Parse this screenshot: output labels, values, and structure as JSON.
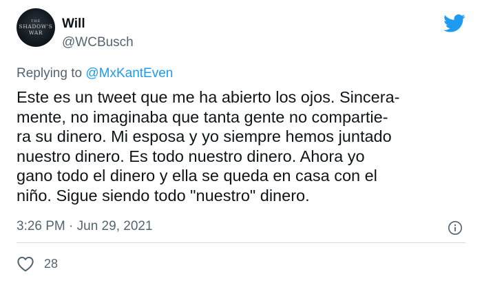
{
  "tweet": {
    "avatar": {
      "top_text": "THE",
      "line1": "SHADOW'S",
      "line2": "WAR"
    },
    "author": {
      "name": "Will",
      "handle": "@WCBusch"
    },
    "brand_icon": "twitter-bird-icon",
    "reply": {
      "prefix": "Replying to",
      "mention": "@MxKantEven"
    },
    "text_lines": [
      "Este es un tweet que me ha abierto los ojos. Sincera-",
      "mente, no imaginaba que tanta gente no compartie-",
      "ra su dinero. Mi esposa y yo siempre hemos juntado",
      "nuestro dinero. Es todo nuestro dinero. Ahora yo",
      "gano todo el dinero y ella se queda en casa con el",
      "niño. Sigue siendo todo \"nuestro\" dinero."
    ],
    "timestamp": "3:26 PM · Jun 29, 2021",
    "info_icon": "info-icon",
    "likes": {
      "icon": "heart-icon",
      "count": "28"
    }
  },
  "colors": {
    "text": "#0f1419",
    "secondary": "#536471",
    "link": "#1d9bf0",
    "brand": "#1d9bf0",
    "divider": "#cfd9de"
  }
}
